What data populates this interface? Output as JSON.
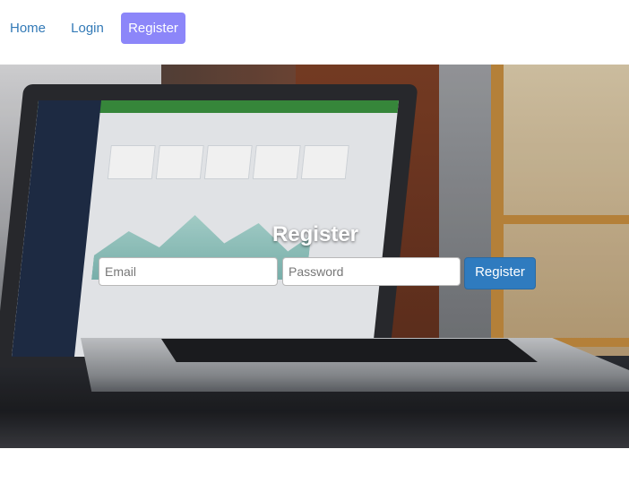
{
  "nav": {
    "items": [
      {
        "label": "Home"
      },
      {
        "label": "Login"
      },
      {
        "label": "Register",
        "active": true
      }
    ],
    "link_color": "#337ab7",
    "active_bg": "#8c86f9"
  },
  "register_form": {
    "title": "Register",
    "email_placeholder": "Email",
    "password_placeholder": "Password",
    "submit_label": "Register",
    "submit_color": "#2f7bbf"
  },
  "hero": {
    "background_image": "laptop-on-desk-photo"
  }
}
